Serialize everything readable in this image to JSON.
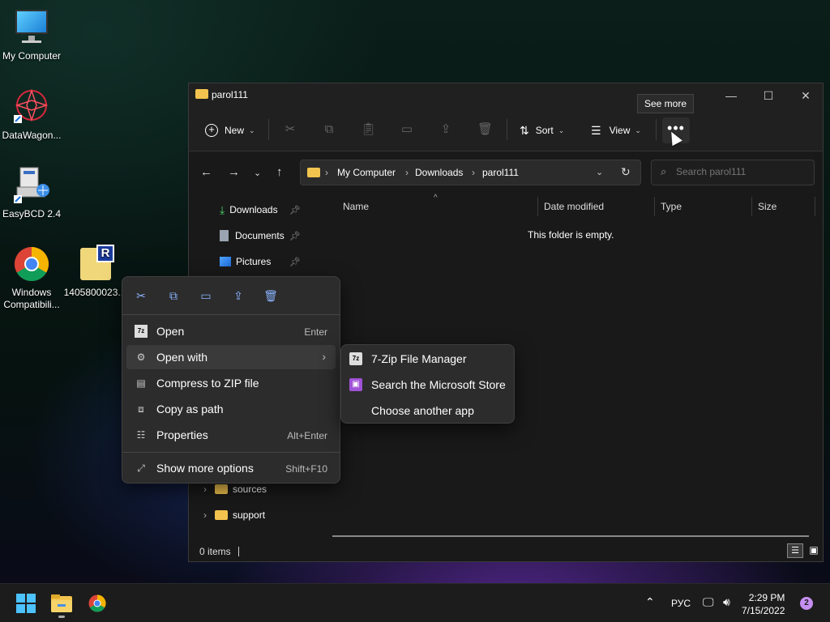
{
  "desktop": {
    "icons": [
      {
        "label": "My Computer"
      },
      {
        "label": "DataWagon..."
      },
      {
        "label": "EasyBCD 2.4"
      },
      {
        "label": "Windows Compatibili..."
      },
      {
        "label": "1405800023..."
      }
    ]
  },
  "window": {
    "title": "parol111",
    "controls": {
      "minimize": "—",
      "maximize": "☐",
      "close": "✕"
    },
    "commandbar": {
      "new_label": "New",
      "sort_label": "Sort",
      "view_label": "View",
      "see_more_label": "•••",
      "tooltip": "See more"
    },
    "address": {
      "crumbs": [
        "My Computer",
        "Downloads",
        "parol111"
      ]
    },
    "search": {
      "placeholder": "Search parol111"
    },
    "sidebar": {
      "items": [
        {
          "label": "Downloads",
          "icon": "download-icon",
          "pinned": true
        },
        {
          "label": "Documents",
          "icon": "document-icon",
          "pinned": true
        },
        {
          "label": "Pictures",
          "icon": "pictures-icon",
          "pinned": true
        },
        {
          "label": "sources",
          "icon": "folder-icon",
          "pinned": false
        },
        {
          "label": "support",
          "icon": "folder-icon",
          "pinned": false
        }
      ]
    },
    "columns": [
      "Name",
      "Date modified",
      "Type",
      "Size"
    ],
    "empty_message": "This folder is empty.",
    "status": {
      "items_count": "0 items"
    }
  },
  "context_menu": {
    "items": [
      {
        "label": "Open",
        "shortcut": "Enter"
      },
      {
        "label": "Open with",
        "shortcut": ""
      },
      {
        "label": "Compress to ZIP file",
        "shortcut": ""
      },
      {
        "label": "Copy as path",
        "shortcut": ""
      },
      {
        "label": "Properties",
        "shortcut": "Alt+Enter"
      },
      {
        "label": "Show more options",
        "shortcut": "Shift+F10"
      }
    ],
    "submenu": [
      {
        "label": "7-Zip File Manager"
      },
      {
        "label": "Search the Microsoft Store"
      },
      {
        "label": "Choose another app"
      }
    ]
  },
  "taskbar": {
    "language": "РУС",
    "time": "2:29 PM",
    "date": "7/15/2022",
    "notification_count": "2"
  },
  "colors": {
    "accent": "#4cc2ff",
    "folder": "#f2c34e",
    "menu_bg": "#2c2c2c"
  }
}
